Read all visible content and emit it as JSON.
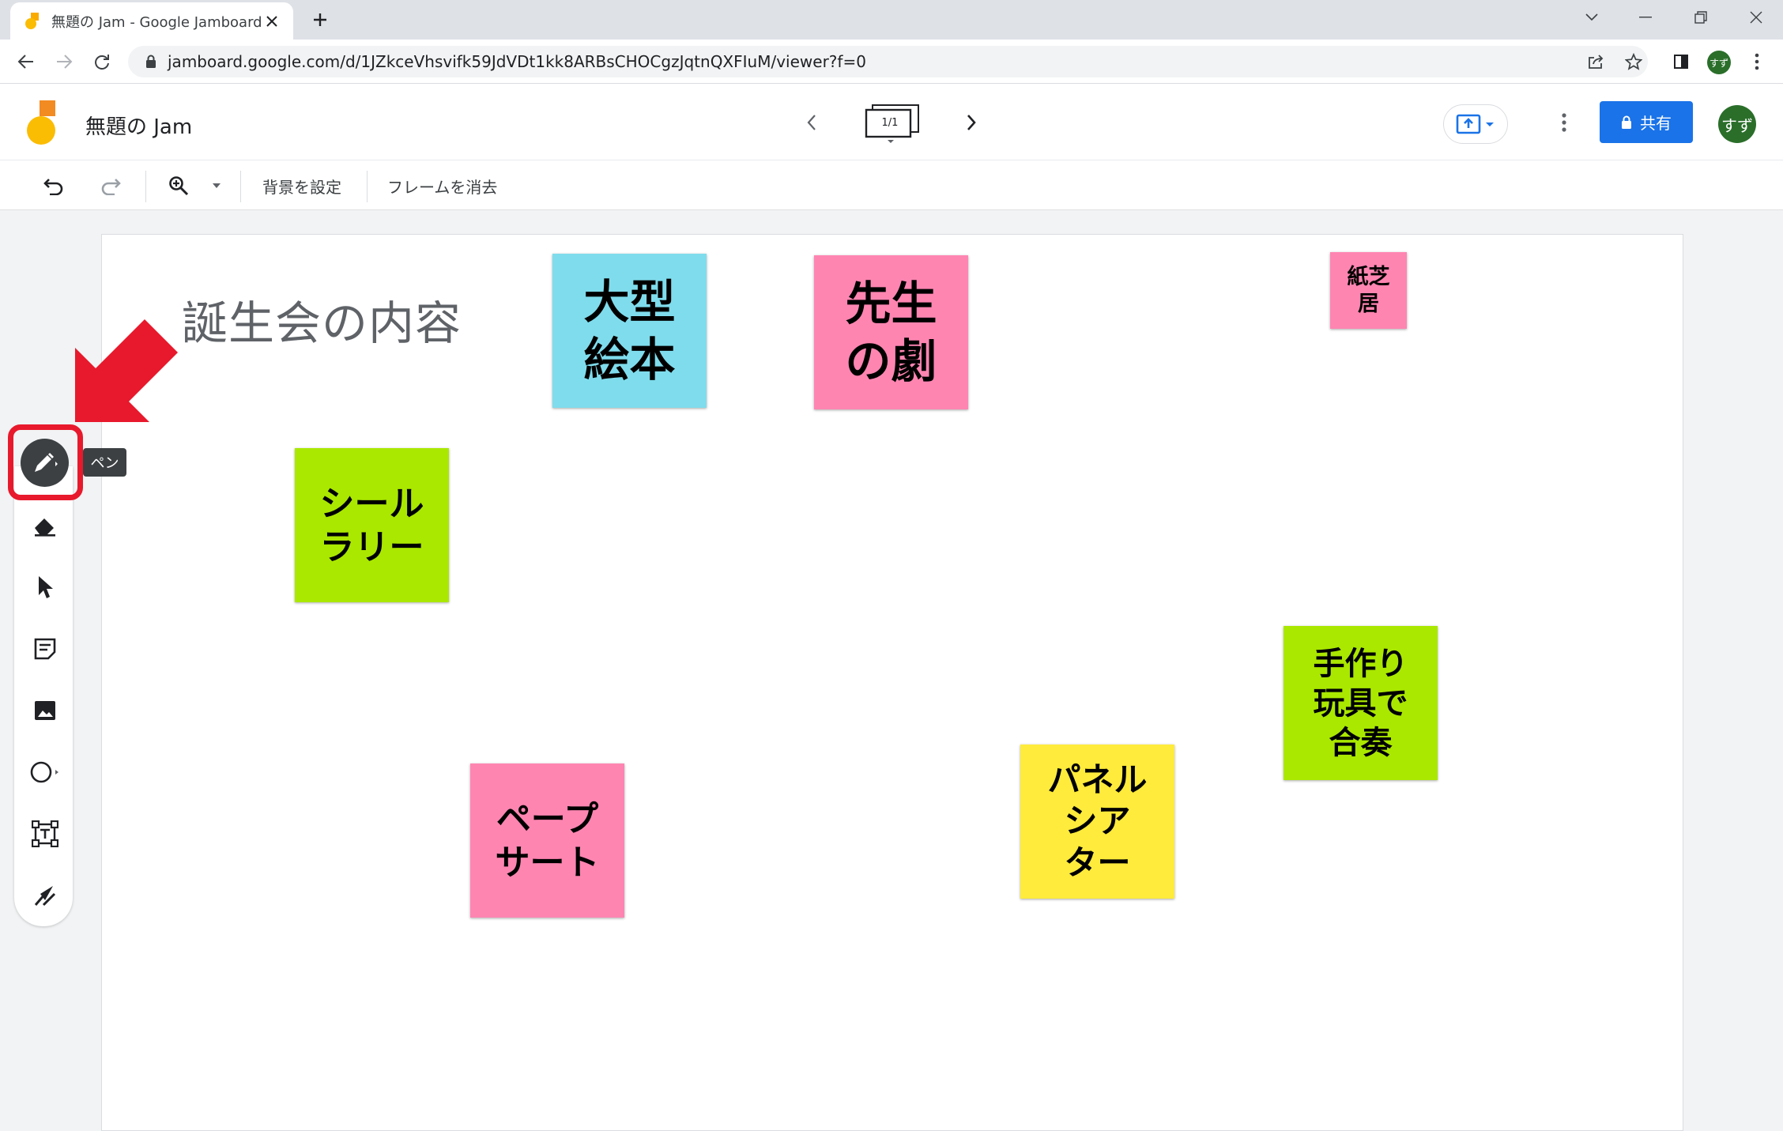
{
  "browser": {
    "tab_title": "無題の Jam - Google Jamboard",
    "url": "jamboard.google.com/d/1JZkceVhsvifk59JdVDt1kk8ARBsCHOCgzJqtnQXFIuM/viewer?f=0",
    "profile_label": "すず"
  },
  "app": {
    "title": "無題の Jam",
    "frame_counter": "1/1",
    "share_label": "共有",
    "avatar_label": "すず",
    "brand_color": "#f9ab00"
  },
  "toolbar": {
    "set_background": "背景を設定",
    "clear_frame": "フレームを消去"
  },
  "canvas": {
    "title": "誕生会の内容",
    "notes": [
      {
        "text": "大型\n絵本",
        "color": "#7fdcec"
      },
      {
        "text": "先生\nの劇",
        "color": "#ff85b1"
      },
      {
        "text": "紙芝\n居",
        "color": "#ff85b1"
      },
      {
        "text": "シール\nラリー",
        "color": "#aae800"
      },
      {
        "text": "手作り\n玩具で\n合奏",
        "color": "#aae800"
      },
      {
        "text": "パネル\nシア\nター",
        "color": "#ffeb3b"
      },
      {
        "text": "ペープ\nサート",
        "color": "#ff85b1"
      }
    ]
  },
  "sidebar": {
    "tooltip": "ペン",
    "tools": [
      "pen-icon",
      "eraser-icon",
      "select-icon",
      "sticky-note-icon",
      "image-icon",
      "circle-icon",
      "text-box-icon",
      "laser-icon"
    ]
  },
  "annotation": {
    "highlight_color": "#e8192c"
  }
}
